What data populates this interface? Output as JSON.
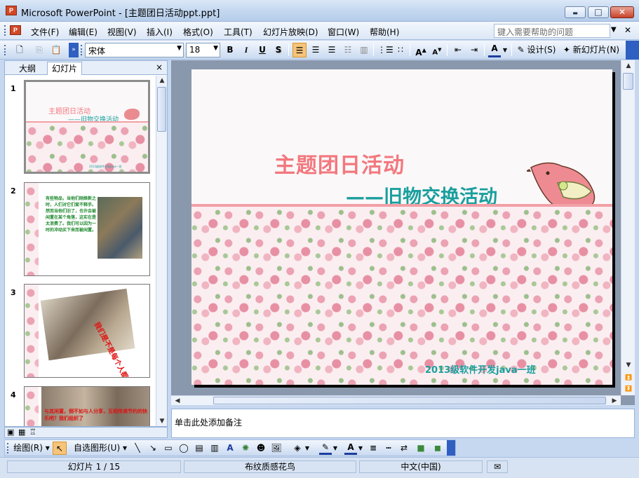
{
  "window": {
    "title": "Microsoft PowerPoint - [主题团日活动ppt.ppt]",
    "app_icon": "P",
    "minimize": "▬",
    "maximize": "□",
    "close": "✕"
  },
  "menu": {
    "items": [
      "文件(F)",
      "编辑(E)",
      "视图(V)",
      "插入(I)",
      "格式(O)",
      "工具(T)",
      "幻灯片放映(D)",
      "窗口(W)",
      "帮助(H)"
    ],
    "help_placeholder": "键入需要帮助的问题",
    "doc_close": "✕"
  },
  "toolbar": {
    "font_name": "宋体",
    "font_size": "18",
    "bold": "B",
    "italic": "I",
    "underline": "U",
    "shadow": "S",
    "font_color_label": "A",
    "design_label": "设计(S)",
    "new_slide_label": "新幻灯片(N)"
  },
  "outline_pane": {
    "tabs": [
      "大纲",
      "幻灯片"
    ],
    "active_tab": "幻灯片",
    "close": "×",
    "slides": [
      {
        "number": "1",
        "title": "主题团日活动",
        "subtitle": "——旧物交换活动",
        "footer": "2013级软件开发java一班"
      },
      {
        "number": "2",
        "text": "有些物品，当他们刚焕新之时，人们对它们爱不释手。然而当他们旧了，也许会被闲置在某个角落，这实在是太浪费了。我们可以因为一时的冲动买下来而被闲置。"
      },
      {
        "number": "3",
        "text": "我们是不是每个人都有一些闲置的东西？"
      },
      {
        "number": "4",
        "text": "与其闲置，倒不如与人分享，互相传递节约的快乐吧？我们组织了"
      }
    ]
  },
  "slide": {
    "title": "主题团日活动",
    "subtitle": "——旧物交换活动",
    "footer": "2013级软件开发java一班"
  },
  "notes": {
    "placeholder": "单击此处添加备注"
  },
  "draw_toolbar": {
    "draw_label": "绘图(R)",
    "autoshapes_label": "自选图形(U)"
  },
  "status": {
    "slide_info": "幻灯片 1 / 15",
    "design": "布纹质感花鸟",
    "language": "中文(中国)"
  },
  "colors": {
    "title": "#f2787e",
    "subtitle": "#1a9f9e",
    "band": "#f2a0a6"
  }
}
